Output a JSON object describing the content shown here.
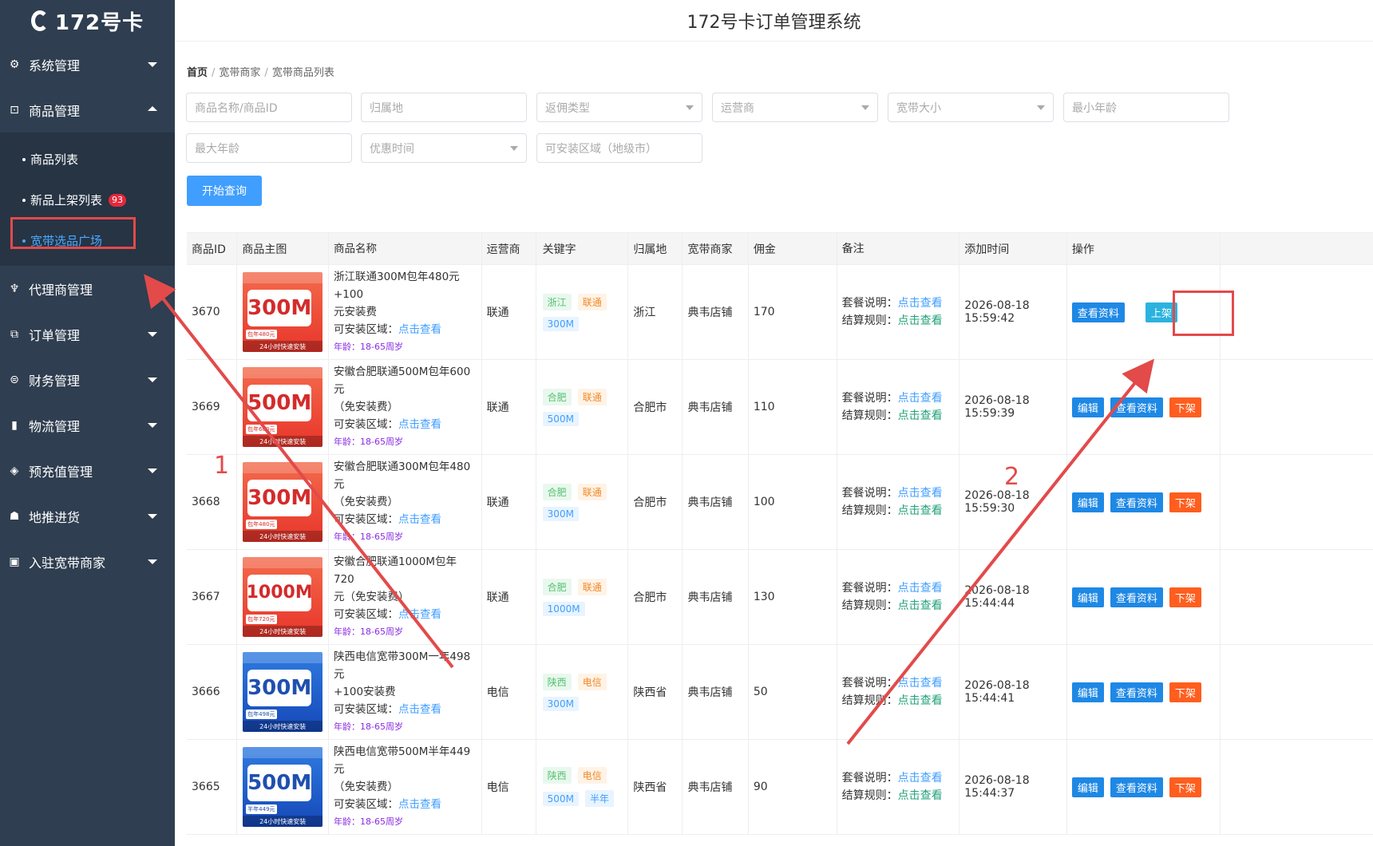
{
  "app": {
    "logo": "172号卡",
    "title": "172号卡订单管理系统"
  },
  "sidebar": {
    "menus": [
      {
        "label": "系统管理",
        "icon": "gear-icon"
      },
      {
        "label": "商品管理",
        "icon": "product-icon"
      },
      {
        "label": "代理商管理",
        "icon": "agent-icon"
      },
      {
        "label": "订单管理",
        "icon": "order-icon"
      },
      {
        "label": "财务管理",
        "icon": "finance-icon"
      },
      {
        "label": "物流管理",
        "icon": "bookmark-icon"
      },
      {
        "label": "预充值管理",
        "icon": "tag-icon"
      },
      {
        "label": "地推进货",
        "icon": "boxes-icon"
      },
      {
        "label": "入驻宽带商家",
        "icon": "money-icon"
      }
    ],
    "submenu": [
      {
        "label": "商品列表"
      },
      {
        "label": "新品上架列表",
        "badge": "93"
      },
      {
        "label": "宽带选品广场"
      }
    ]
  },
  "breadcrumb": [
    "首页",
    "宽带商家",
    "宽带商品列表"
  ],
  "filters": {
    "name": "商品名称/商品ID",
    "region": "归属地",
    "commission_type": "返佣类型",
    "operator": "运营商",
    "bandwidth": "宽带大小",
    "min_age": "最小年龄",
    "max_age": "最大年龄",
    "promo_time": "优惠时间",
    "install_area": "可安装区域（地级市）",
    "search_button": "开始查询"
  },
  "table": {
    "headers": [
      "商品ID",
      "商品主图",
      "商品名称",
      "运营商",
      "关键字",
      "归属地",
      "宽带商家",
      "佣金",
      "备注",
      "添加时间",
      "操作"
    ],
    "install_label": "可安装区域：",
    "install_link": "点击查看",
    "note_pkg": "套餐说明：",
    "note_rule": "结算规则：",
    "note_link": "点击查看",
    "rows": [
      {
        "id": "3670",
        "name1": "浙江联通300M包年480元+100",
        "name2": "元安装费",
        "age": "年龄：18-65周岁",
        "speed": "300M",
        "price": "包年480元",
        "operator": "联通",
        "kw1": "浙江",
        "kw2": "联通",
        "kw3": "300M",
        "loc": "浙江",
        "shop": "典韦店铺",
        "com": "170",
        "time": "2026-08-18 15:59:42",
        "btn_view": "查看资料",
        "btn_list": "上架"
      },
      {
        "id": "3669",
        "name1": "安徽合肥联通500M包年600元",
        "name2": "（免安装费）",
        "age": "年龄：18-65周岁",
        "speed": "500M",
        "price": "包年600元",
        "operator": "联通",
        "kw1": "合肥",
        "kw2": "联通",
        "kw3": "500M",
        "loc": "合肥市",
        "shop": "典韦店铺",
        "com": "110",
        "time": "2026-08-18 15:59:39",
        "btn_edit": "编辑",
        "btn_view": "查看资料",
        "btn_off": "下架"
      },
      {
        "id": "3668",
        "name1": "安徽合肥联通300M包年480元",
        "name2": "（免安装费）",
        "age": "年龄：18-65周岁",
        "speed": "300M",
        "price": "包年480元",
        "operator": "联通",
        "kw1": "合肥",
        "kw2": "联通",
        "kw3": "300M",
        "loc": "合肥市",
        "shop": "典韦店铺",
        "com": "100",
        "time": "2026-08-18 15:59:30",
        "btn_edit": "编辑",
        "btn_view": "查看资料",
        "btn_off": "下架"
      },
      {
        "id": "3667",
        "name1": "安徽合肥联通1000M包年720",
        "name2": "元（免安装费）",
        "age": "年龄：18-65周岁",
        "speed": "1000M",
        "price": "包年720元",
        "operator": "联通",
        "kw1": "合肥",
        "kw2": "联通",
        "kw3": "1000M",
        "loc": "合肥市",
        "shop": "典韦店铺",
        "com": "130",
        "time": "2026-08-18 15:44:44",
        "btn_edit": "编辑",
        "btn_view": "查看资料",
        "btn_off": "下架"
      },
      {
        "id": "3666",
        "name1": "陕西电信宽带300M一年498元",
        "name2": "+100安装费",
        "age": "年龄：18-65周岁",
        "speed": "300M",
        "price": "包年498元",
        "operator": "电信",
        "kw1": "陕西",
        "kw2": "电信",
        "kw3": "300M",
        "loc": "陕西省",
        "shop": "典韦店铺",
        "com": "50",
        "time": "2026-08-18 15:44:41",
        "btn_edit": "编辑",
        "btn_view": "查看资料",
        "btn_off": "下架"
      },
      {
        "id": "3665",
        "name1": "陕西电信宽带500M半年449元",
        "name2": "（免安装费）",
        "age": "年龄：18-65周岁",
        "speed": "500M",
        "price": "半年449元",
        "operator": "电信",
        "kw1": "陕西",
        "kw2": "电信",
        "kw3": "500M",
        "kw4": "半年",
        "loc": "陕西省",
        "shop": "典韦店铺",
        "com": "90",
        "time": "2026-08-18 15:44:37",
        "btn_edit": "编辑",
        "btn_view": "查看资料",
        "btn_off": "下架"
      }
    ]
  },
  "annotations": {
    "n1": "1",
    "n2": "2"
  },
  "thumb_text": {
    "bottom": "24小时快速安装"
  },
  "colors": {
    "sidebar": "#2f3e50",
    "primary": "#409eff",
    "danger": "#ff5e1f",
    "annotation": "#e34a4a"
  }
}
